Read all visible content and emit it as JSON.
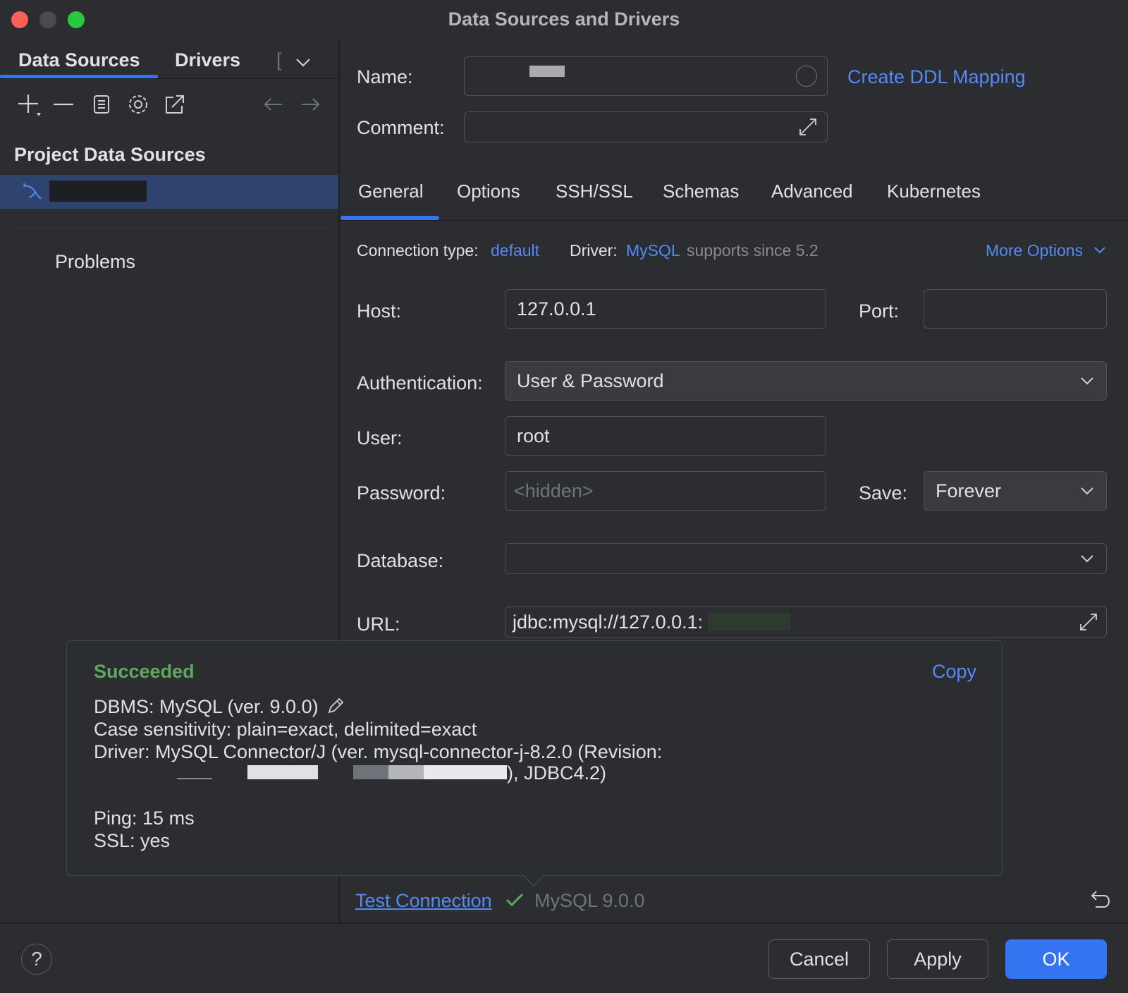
{
  "window": {
    "title": "Data Sources and Drivers"
  },
  "left": {
    "tabs": [
      "Data Sources",
      "Drivers"
    ],
    "more_tab": "[",
    "section_title": "Project Data Sources",
    "problems": "Problems"
  },
  "form": {
    "name_label": "Name:",
    "comment_label": "Comment:",
    "create_ddl": "Create DDL Mapping",
    "tabs": [
      "General",
      "Options",
      "SSH/SSL",
      "Schemas",
      "Advanced",
      "Kubernetes"
    ],
    "connection_type_label": "Connection type:",
    "connection_type_value": "default",
    "driver_label": "Driver:",
    "driver_value": "MySQL",
    "driver_note": "supports since 5.2",
    "more_options": "More Options",
    "host_label": "Host:",
    "host_value": "127.0.0.1",
    "port_label": "Port:",
    "port_value": "",
    "auth_label": "Authentication:",
    "auth_value": "User & Password",
    "user_label": "User:",
    "user_value": "root",
    "password_label": "Password:",
    "password_placeholder": "<hidden>",
    "save_label": "Save:",
    "save_value": "Forever",
    "database_label": "Database:",
    "database_value": "",
    "url_label": "URL:",
    "url_value": "jdbc:mysql://127.0.0.1:"
  },
  "popup": {
    "status": "Succeeded",
    "copy": "Copy",
    "dbms": "DBMS: MySQL (ver. 9.0.0)",
    "case": "Case sensitivity: plain=exact, delimited=exact",
    "driver": "Driver: MySQL Connector/J (ver. mysql-connector-j-8.2.0 (Revision:",
    "driver_end": "), JDBC4.2)",
    "ping": "Ping: 15 ms",
    "ssl": "SSL: yes"
  },
  "test": {
    "link": "Test Connection",
    "result": "MySQL 9.0.0"
  },
  "buttons": {
    "help": "?",
    "cancel": "Cancel",
    "apply": "Apply",
    "ok": "OK"
  },
  "colors": {
    "accent": "#3574f0",
    "link": "#548af7",
    "success": "#5fa85f",
    "selection": "#2e436e"
  }
}
